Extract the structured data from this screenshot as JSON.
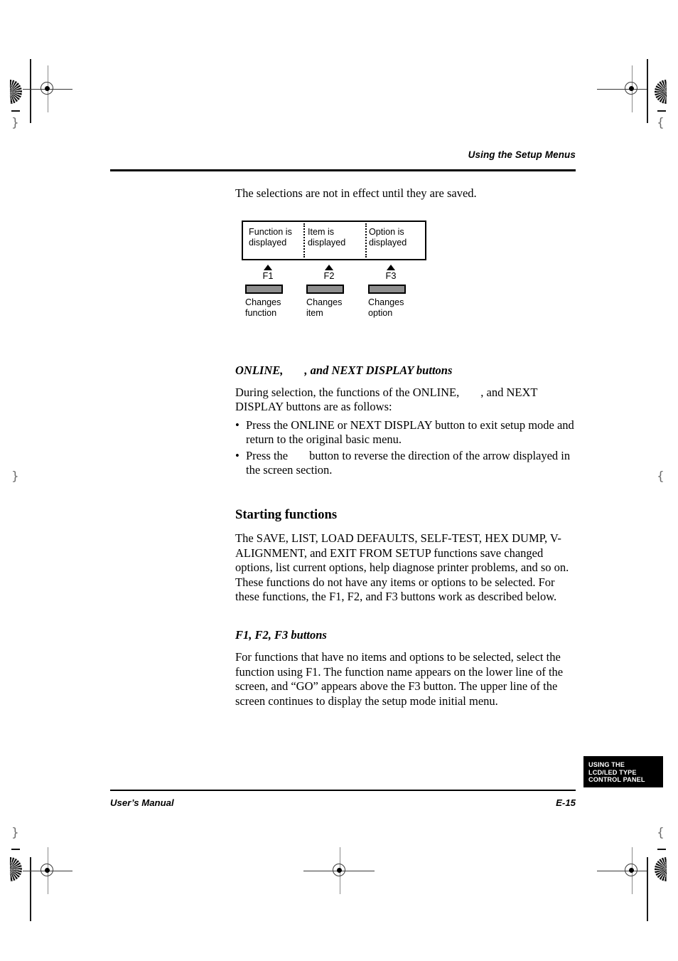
{
  "page": {
    "running_head": "Using the Setup Menus",
    "intro_paragraph": "The selections are not in effect until they are saved."
  },
  "diagram": {
    "screen_cells": [
      {
        "line1": "Function is",
        "line2": "displayed"
      },
      {
        "line1": "Item is",
        "line2": "displayed"
      },
      {
        "line1": "Option is",
        "line2": "displayed"
      }
    ],
    "buttons": [
      {
        "key": "F1",
        "caption_line1": "Changes",
        "caption_line2": "function"
      },
      {
        "key": "F2",
        "caption_line1": "Changes",
        "caption_line2": "item"
      },
      {
        "key": "F3",
        "caption_line1": "Changes",
        "caption_line2": "option"
      }
    ],
    "keycap_color": "#8e8e8e",
    "arrow_glyph": "up-triangle"
  },
  "sections": [
    {
      "heading_part1": "ONLINE,",
      "heading_part2": ", and NEXT DISPLAY buttons",
      "paragraph_part1": "During selection, the functions of the ONLINE,",
      "paragraph_part2": ", and NEXT DISPLAY buttons are as follows:",
      "bullets": [
        {
          "marker": "•",
          "text": "Press the ONLINE or NEXT DISPLAY button to exit setup mode and return to the original basic menu."
        },
        {
          "marker": "•",
          "text_part1": "Press the",
          "text_part2": "button to reverse the direction of the arrow displayed in the screen section."
        }
      ]
    },
    {
      "heading": "Starting functions",
      "paragraph": "The SAVE, LIST, LOAD DEFAULTS, SELF-TEST, HEX DUMP, V-ALIGNMENT, and EXIT FROM SETUP functions save changed options, list current options, help diagnose printer problems, and so on. These functions do not have any items or options to be selected. For these functions, the F1, F2, and F3 buttons work as described below."
    },
    {
      "heading": "F1, F2, F3 buttons",
      "paragraph": "For functions that have no items and options to be selected, select the function using F1. The function name appears on the lower line of the screen, and “GO” appears above the F3 button. The upper line of the screen continues to display the setup mode initial menu."
    }
  ],
  "footer": {
    "tab_line1": "USING THE",
    "tab_line2": "LCD/LED TYPE",
    "tab_line3": "CONTROL PANEL",
    "manual_label": "User’s Manual",
    "page_number": "E-15"
  },
  "marks": {
    "bracket_left": "}",
    "bracket_right": "{"
  }
}
